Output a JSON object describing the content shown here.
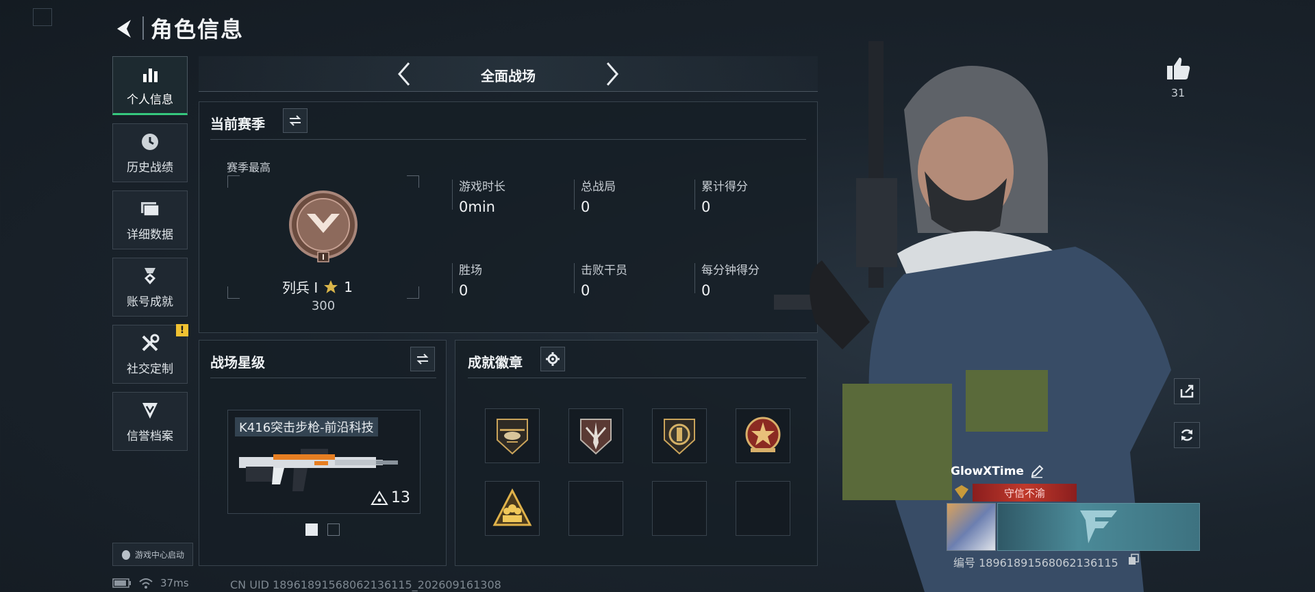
{
  "header": {
    "title": "角色信息"
  },
  "sidebar": {
    "items": [
      {
        "label": "个人信息",
        "icon": "bar-chart-icon",
        "active": true
      },
      {
        "label": "历史战绩",
        "icon": "clock-icon"
      },
      {
        "label": "详细数据",
        "icon": "folder-icon"
      },
      {
        "label": "账号成就",
        "icon": "medal-icon"
      },
      {
        "label": "社交定制",
        "icon": "tools-icon",
        "badge": "!"
      },
      {
        "label": "信誉档案",
        "icon": "shield-icon"
      }
    ],
    "launch_label": "游戏中心启动"
  },
  "mode": {
    "title": "全面战场"
  },
  "season": {
    "title": "当前赛季",
    "best_label": "赛季最高",
    "rank_name": "列兵 I",
    "rank_stars": "1",
    "rank_points": "300",
    "stats": [
      {
        "label": "游戏时长",
        "value": "0min"
      },
      {
        "label": "总战局",
        "value": "0"
      },
      {
        "label": "累计得分",
        "value": "0"
      },
      {
        "label": "胜场",
        "value": "0"
      },
      {
        "label": "击败干员",
        "value": "0"
      },
      {
        "label": "每分钟得分",
        "value": "0"
      }
    ]
  },
  "star_level": {
    "title": "战场星级",
    "weapon_name": "K416突击步枪-前沿科技",
    "weapon_level": "13"
  },
  "achievements": {
    "title": "成就徽章",
    "badges": [
      "helicopter-badge",
      "dagger-shield-badge",
      "round-emblem-badge",
      "star-seal-badge",
      "team-badge",
      "",
      "",
      ""
    ]
  },
  "profile": {
    "likes": "31",
    "player_name": "GlowXTime",
    "motto": "守信不渝",
    "player_id": "编号 1896189156806213611​5"
  },
  "status": {
    "ping": "37ms",
    "uid": "CN UID 1896189156806213611​5_202609161308"
  }
}
